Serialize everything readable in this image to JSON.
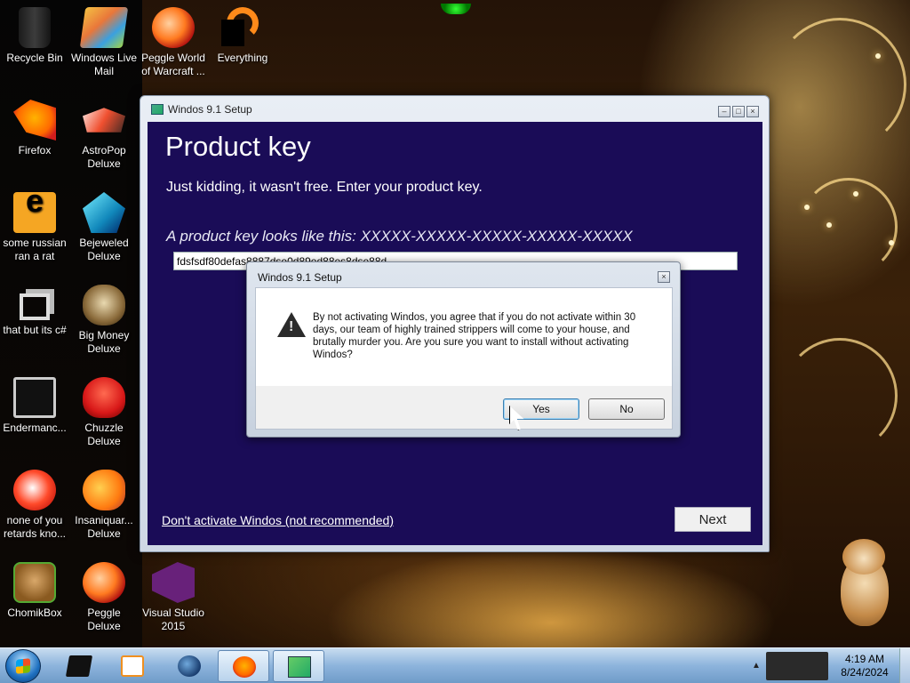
{
  "desktop": {
    "icons": [
      {
        "label": "Recycle Bin",
        "icon": "recycle-bin-icon"
      },
      {
        "label": "Windows Live Mail",
        "icon": "windows-live-mail-icon"
      },
      {
        "label": "Peggle World of Warcraft ...",
        "icon": "peggle-wow-icon"
      },
      {
        "label": "Everything",
        "icon": "everything-icon"
      },
      {
        "label": "Firefox",
        "icon": "firefox-icon"
      },
      {
        "label": "AstroPop Deluxe",
        "icon": "astropop-icon"
      },
      {
        "label": "some russian ran a rat",
        "icon": "some-russian-icon"
      },
      {
        "label": "Bejeweled Deluxe",
        "icon": "bejeweled-icon"
      },
      {
        "label": "that but its c#",
        "icon": "that-but-csharp-icon"
      },
      {
        "label": "Big Money Deluxe",
        "icon": "big-money-icon"
      },
      {
        "label": "Endermanc...",
        "icon": "endermanc-icon"
      },
      {
        "label": "Chuzzle Deluxe",
        "icon": "chuzzle-icon"
      },
      {
        "label": "none of you retards kno...",
        "icon": "none-of-you-icon"
      },
      {
        "label": "Insaniquar... Deluxe",
        "icon": "insaniquarium-icon"
      },
      {
        "label": "ChomikBox",
        "icon": "chomikbox-icon"
      },
      {
        "label": "Peggle Deluxe",
        "icon": "peggle-deluxe-icon"
      },
      {
        "label": "Visual Studio 2015",
        "icon": "visual-studio-icon"
      }
    ]
  },
  "setup_window": {
    "title": "Windos 9.1 Setup",
    "heading": "Product key",
    "subtitle": "Just kidding, it wasn't free. Enter your product key.",
    "example": "A product key looks like this: XXXXX-XXXXX-XXXXX-XXXXX-XXXXX",
    "key_value": "fdsfsdf80defas8887dse0d89ed88es8dse88d",
    "dont_activate_link": "Don't activate Windos (not recommended)",
    "next_label": "Next"
  },
  "dialog": {
    "title": "Windos 9.1 Setup",
    "message": "By not activating Windos, you agree that if you do not activate within 30 days, our team of highly trained strippers will come to your house, and brutally murder you. Are you sure you want to install without activating Windos?",
    "yes_label": "Yes",
    "no_label": "No",
    "icon": "warning-icon"
  },
  "taskbar": {
    "start": "start-orb-icon",
    "buttons": [
      "app-icon",
      "media-player-icon",
      "globe-icon",
      "firefox-icon",
      "setup-icon"
    ],
    "clock_time": "4:19 AM",
    "clock_date": "8/24/2024"
  }
}
